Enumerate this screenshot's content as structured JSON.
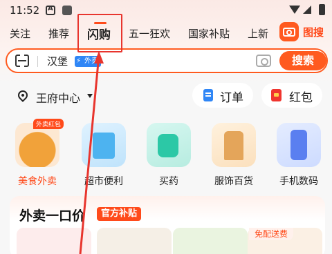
{
  "status_bar": {
    "time": "11:52"
  },
  "tabs": [
    {
      "label": "关注"
    },
    {
      "label": "推荐"
    },
    {
      "label": "闪购"
    },
    {
      "label": "五一狂欢"
    },
    {
      "label": "国家补贴"
    },
    {
      "label": "上新"
    }
  ],
  "image_search_label": "图搜",
  "search": {
    "query": "汉堡",
    "badge": "外卖",
    "button_label": "搜索"
  },
  "location": {
    "text": "王府中心"
  },
  "quick_actions": [
    {
      "label": "订单"
    },
    {
      "label": "红包"
    }
  ],
  "categories": [
    {
      "label": "美食外卖",
      "tag": "外卖红包"
    },
    {
      "label": "超市便利"
    },
    {
      "label": "买药"
    },
    {
      "label": "服饰百货"
    },
    {
      "label": "手机数码"
    }
  ],
  "promo_panel": {
    "title": "外卖一口价",
    "badge": "官方补贴",
    "product_tag": "免配送费"
  },
  "colors": {
    "accent": "#ff5a1f",
    "annotation": "#e8352e"
  }
}
